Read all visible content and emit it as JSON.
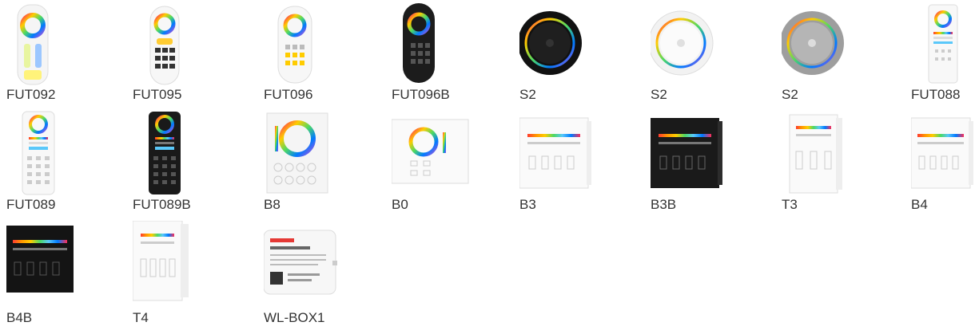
{
  "products": [
    {
      "label": "FUT092",
      "icon": "remote-icon"
    },
    {
      "label": "FUT095",
      "icon": "remote-icon"
    },
    {
      "label": "FUT096",
      "icon": "remote-icon"
    },
    {
      "label": "FUT096B",
      "icon": "remote-icon"
    },
    {
      "label": "S2",
      "icon": "round-remote-icon"
    },
    {
      "label": "S2",
      "icon": "round-remote-icon"
    },
    {
      "label": "S2",
      "icon": "round-remote-icon"
    },
    {
      "label": "FUT088",
      "icon": "remote-icon"
    },
    {
      "label": "FUT089",
      "icon": "remote-icon"
    },
    {
      "label": "FUT089B",
      "icon": "remote-icon"
    },
    {
      "label": "B8",
      "icon": "wall-panel-icon"
    },
    {
      "label": "B0",
      "icon": "wall-panel-icon"
    },
    {
      "label": "B3",
      "icon": "wall-panel-icon"
    },
    {
      "label": "B3B",
      "icon": "wall-panel-icon"
    },
    {
      "label": "T3",
      "icon": "wall-panel-icon"
    },
    {
      "label": "B4",
      "icon": "wall-panel-icon"
    },
    {
      "label": "B4B",
      "icon": "wall-panel-icon"
    },
    {
      "label": "T4",
      "icon": "wall-panel-icon"
    },
    {
      "label": "WL-BOX1",
      "icon": "gateway-box-icon"
    }
  ],
  "colors": {
    "label": "#333333",
    "panel_white": "#f4f4f4",
    "panel_black": "#1a1a1a",
    "rainbow": [
      "#ff3b30",
      "#ff9500",
      "#ffcc00",
      "#4cd964",
      "#5ac8fa",
      "#007aff",
      "#5856d6",
      "#ff2d55"
    ]
  }
}
